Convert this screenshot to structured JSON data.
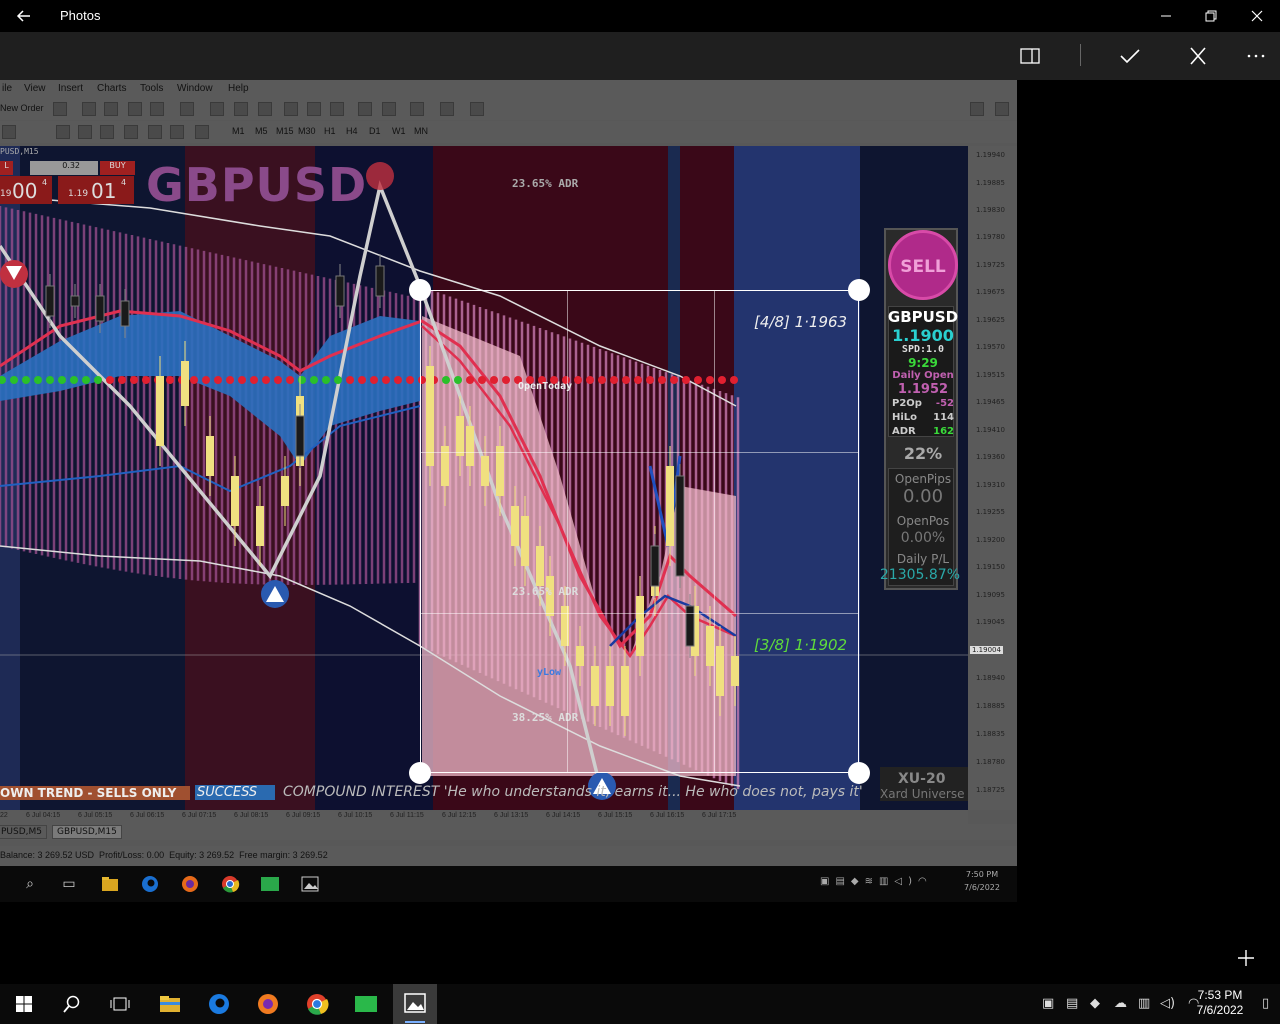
{
  "photos": {
    "title": "Photos",
    "back_icon": "arrow-left-icon",
    "aspect_icon": "aspect-ratio-icon",
    "accept_icon": "check-icon",
    "cancel_icon": "close-icon",
    "more_icon": "more-icon",
    "add_icon": "plus-icon"
  },
  "mt4": {
    "menu": [
      "ile",
      "View",
      "Insert",
      "Charts",
      "Tools",
      "Window",
      "Help"
    ],
    "new_order": "New Order",
    "timeframes": [
      "M1",
      "M5",
      "M15",
      "M30",
      "H1",
      "H4",
      "D1",
      "W1",
      "MN"
    ],
    "chart_title": "PUSD,M15",
    "symbol_watermark": "GBPUSD",
    "one_click": {
      "sell_label": "L",
      "buy_label": "BUY",
      "lot": "0.32",
      "sell_price_big": "00",
      "sell_price_prefix": "19",
      "sell_price_sup": "4",
      "buy_price_prefix": "1.19",
      "buy_price_big": "01",
      "buy_price_sup": "4"
    },
    "annotations": {
      "adr_top": "23.65% ADR",
      "adr_mid": "23.65% ADR",
      "adr_low": "38.25% ADR",
      "level_48": "[4/8] 1·1963",
      "level_38": "[3/8] 1·1902",
      "open_today": "OpenToday",
      "ylow": "yLow"
    },
    "panel": {
      "sell": "SELL",
      "symbol": "GBPUSD",
      "price": "1.1900",
      "spd": "SPD:1.0",
      "time": "9:29",
      "daily_open_label": "Daily Open",
      "daily_open": "1.1952",
      "p2op_label": "P2Op",
      "p2op": "-52",
      "hilo_label": "HiLo",
      "hilo": "114",
      "adr_label": "ADR",
      "adr": "162",
      "pct": "22%",
      "openpips_label": "OpenPips",
      "openpips": "0.00",
      "openpos_label": "OpenPos",
      "openpos": "0.00%",
      "dailypl_label": "Daily P/L",
      "dailypl": "21305.87%"
    },
    "ticker": {
      "trend": "OWN TREND - SELLS ONLY",
      "success": "SUCCESS",
      "quote": "COMPOUND INTEREST 'He who understands it, earns it... He who does not, pays it'",
      "brand_top": "XU-20",
      "brand_bottom": "Xard Universe"
    },
    "price_axis": [
      "1.19940",
      "1.19885",
      "1.19830",
      "1.19780",
      "1.19725",
      "1.19675",
      "1.19625",
      "1.19570",
      "1.19515",
      "1.19465",
      "1.19410",
      "1.19360",
      "1.19310",
      "1.19255",
      "1.19200",
      "1.19150",
      "1.19095",
      "1.19045",
      "1.19004",
      "1.18940",
      "1.18885",
      "1.18835",
      "1.18780",
      "1.18725"
    ],
    "current_price": "1.19004",
    "time_axis": [
      "22",
      "6 Jul 04:15",
      "6 Jul 05:15",
      "6 Jul 06:15",
      "6 Jul 07:15",
      "6 Jul 08:15",
      "6 Jul 09:15",
      "6 Jul 10:15",
      "6 Jul 11:15",
      "6 Jul 12:15",
      "6 Jul 13:15",
      "6 Jul 14:15",
      "6 Jul 15:15",
      "6 Jul 16:15",
      "6 Jul 17:15"
    ],
    "tabs": [
      "PUSD,M5",
      "GBPUSD,M15"
    ],
    "status": "Balance: 3 269.52 USD  Profit/Loss: 0.00  Equity: 3 269.52  Free margin: 3 269.52",
    "inner_clock_time": "7:50 PM",
    "inner_clock_date": "7/6/2022"
  },
  "taskbar": {
    "time": "7:53 PM",
    "date": "7/6/2022"
  }
}
